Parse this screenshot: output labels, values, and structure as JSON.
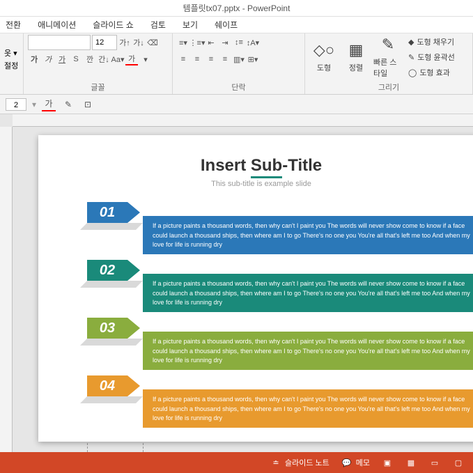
{
  "title": {
    "filename": "템플릿tx07.pptx",
    "app": "PowerPoint",
    "full": "템플릿tx07.pptx - PowerPoint"
  },
  "menu": {
    "transition": "전환",
    "animation": "애니메이션",
    "slideshow": "슬라이드 쇼",
    "review": "검토",
    "view": "보기",
    "shape": "쉐이프"
  },
  "ribbon": {
    "group_left_1": "옷 ▾",
    "group_left_2": "절정",
    "font_size": "12",
    "font_group": "글꼴",
    "paragraph_group": "단락",
    "drawing_group": "그리기",
    "shapes": "도형",
    "arrange": "정렬",
    "quick_styles": "빠른 스타일",
    "shape_fill": "도형 채우기",
    "shape_outline": "도형 윤곽선",
    "shape_effects": "도형 효과"
  },
  "quickbar": {
    "value": "2"
  },
  "slide": {
    "title_pre": "Insert ",
    "title_underline": "Sub",
    "title_post": "-Title",
    "subtitle": "This sub-title is example slide",
    "body_text": "If a picture paints a thousand words, then why can't I paint you The words will never show come to know if a face could launch a thousand ships, then where am I to go There's no one you You're all that's left me too And when my love for life  is running dry",
    "items": [
      {
        "num": "01"
      },
      {
        "num": "02"
      },
      {
        "num": "03"
      },
      {
        "num": "04"
      }
    ]
  },
  "status": {
    "notes": "슬라이드 노트",
    "memo": "메모"
  }
}
